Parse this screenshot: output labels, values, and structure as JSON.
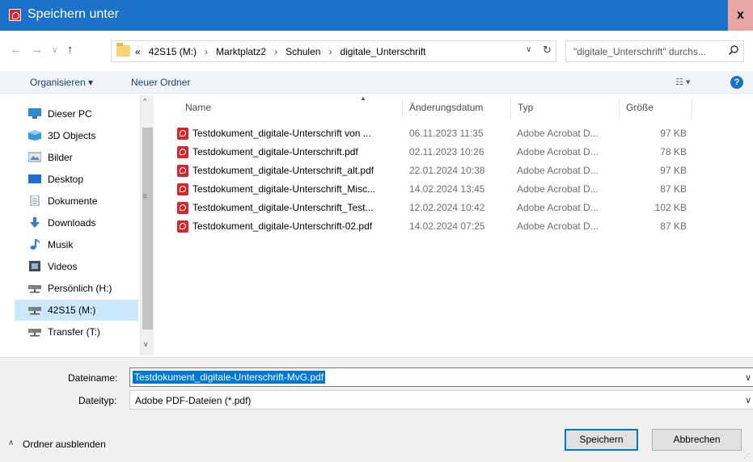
{
  "window": {
    "title": "Speichern unter",
    "close_label": "x",
    "colors": {
      "titlebar": "#1c72c9",
      "selection": "#0078d7",
      "nav_selected": "#cce8ff",
      "pdf_icon": "#d6262c"
    }
  },
  "address": {
    "crumbs": [
      "«",
      "42S15 (M:)",
      "›",
      "Marktplatz2",
      "›",
      "Schulen",
      "›",
      "digitale_Unterschrift"
    ],
    "search_placeholder": "\"digitale_Unterschrift\" durchs..."
  },
  "toolbar": {
    "organize_label": "Organisieren ▾",
    "new_folder_label": "Neuer Ordner",
    "view_label": "☷ ▾",
    "help_label": "?"
  },
  "nav": {
    "items": [
      {
        "label": "Dieser PC",
        "icon": "this-pc-icon"
      },
      {
        "label": "3D Objects",
        "icon": "3d-objects-icon"
      },
      {
        "label": "Bilder",
        "icon": "pictures-icon"
      },
      {
        "label": "Desktop",
        "icon": "desktop-icon"
      },
      {
        "label": "Dokumente",
        "icon": "documents-icon"
      },
      {
        "label": "Downloads",
        "icon": "downloads-icon"
      },
      {
        "label": "Musik",
        "icon": "music-icon"
      },
      {
        "label": "Videos",
        "icon": "videos-icon"
      },
      {
        "label": "Persönlich (H:)",
        "icon": "network-drive-icon"
      },
      {
        "label": "42S15 (M:)",
        "icon": "network-drive-icon",
        "selected": true
      },
      {
        "label": "Transfer (T:)",
        "icon": "network-drive-icon"
      }
    ]
  },
  "files": {
    "columns": {
      "name": "Name",
      "modified": "Änderungsdatum",
      "type": "Typ",
      "size": "Größe"
    },
    "rows": [
      {
        "name": "Testdokument_digitale-Unterschrift von ...",
        "modified": "06.11.2023 11:35",
        "type": "Adobe Acrobat D...",
        "size": "97 KB"
      },
      {
        "name": "Testdokument_digitale-Unterschrift.pdf",
        "modified": "02.11.2023 10:26",
        "type": "Adobe Acrobat D...",
        "size": "78 KB"
      },
      {
        "name": "Testdokument_digitale-Unterschrift_alt.pdf",
        "modified": "22.01.2024 10:38",
        "type": "Adobe Acrobat D...",
        "size": "97 KB"
      },
      {
        "name": "Testdokument_digitale-Unterschrift_Misc...",
        "modified": "14.02.2024 13:45",
        "type": "Adobe Acrobat D...",
        "size": "87 KB"
      },
      {
        "name": "Testdokument_digitale-Unterschrift_Test...",
        "modified": "12.02.2024 10:42",
        "type": "Adobe Acrobat D...",
        "size": "102 KB"
      },
      {
        "name": "Testdokument_digitale-Unterschrift-02.pdf",
        "modified": "14.02.2024 07:25",
        "type": "Adobe Acrobat D...",
        "size": "87 KB"
      }
    ]
  },
  "form": {
    "filename_label": "Dateiname:",
    "filename_value": "Testdokument_digitale-Unterschrift-MvG.pdf",
    "filetype_label": "Dateityp:",
    "filetype_value": "Adobe PDF-Dateien (*.pdf)",
    "hide_folders_label": "Ordner ausblenden",
    "save_label": "Speichern",
    "cancel_label": "Abbrechen"
  }
}
